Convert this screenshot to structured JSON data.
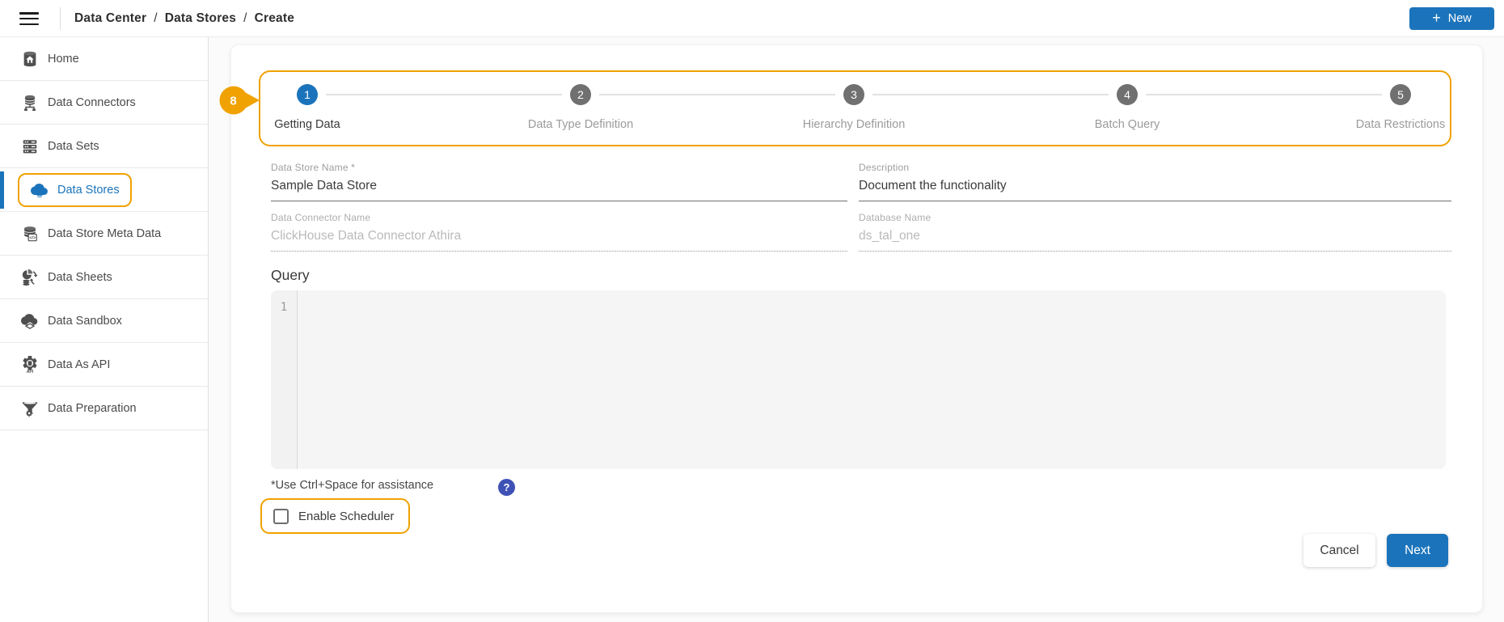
{
  "topbar": {
    "breadcrumb": [
      "Data Center",
      "Data Stores",
      "Create"
    ],
    "separator": "/",
    "new_button": {
      "plus": "+",
      "label": "New"
    }
  },
  "sidebar": {
    "items": [
      {
        "label": "Home",
        "icon": "database-home-icon",
        "active": false
      },
      {
        "label": "Data Connectors",
        "icon": "database-stack-icon",
        "active": false
      },
      {
        "label": "Data Sets",
        "icon": "server-rack-icon",
        "active": false
      },
      {
        "label": "Data Stores",
        "icon": "cloud-icon",
        "active": true
      },
      {
        "label": "Data Store Meta Data",
        "icon": "database-code-icon",
        "active": false
      },
      {
        "label": "Data Sheets",
        "icon": "chart-sync-icon",
        "active": false
      },
      {
        "label": "Data Sandbox",
        "icon": "cloud-box-icon",
        "active": false
      },
      {
        "label": "Data As API",
        "icon": "gear-api-icon",
        "active": false
      },
      {
        "label": "Data Preparation",
        "icon": "funnel-gear-icon",
        "active": false
      }
    ]
  },
  "annotation_badge": {
    "label": "8"
  },
  "stepper": {
    "steps": [
      {
        "number": "1",
        "label": "Getting Data",
        "state": "active"
      },
      {
        "number": "2",
        "label": "Data Type Definition",
        "state": "inactive"
      },
      {
        "number": "3",
        "label": "Hierarchy Definition",
        "state": "inactive"
      },
      {
        "number": "4",
        "label": "Batch Query",
        "state": "inactive"
      },
      {
        "number": "5",
        "label": "Data Restrictions",
        "state": "inactive"
      }
    ]
  },
  "form": {
    "fields": {
      "data_store_name": {
        "label": "Data Store Name *",
        "value": "Sample Data Store",
        "disabled": false
      },
      "description": {
        "label": "Description",
        "value": "Document the functionality",
        "disabled": false
      },
      "data_connector_name": {
        "label": "Data Connector Name",
        "value": "ClickHouse Data Connector Athira",
        "disabled": true
      },
      "database_name": {
        "label": "Database Name",
        "value": "ds_tal_one",
        "disabled": true
      }
    },
    "query": {
      "heading": "Query",
      "line_number": "1",
      "content": ""
    },
    "hint": "*Use Ctrl+Space for assistance",
    "help_icon": "?",
    "scheduler": {
      "label": "Enable Scheduler",
      "checked": false
    }
  },
  "actions": {
    "cancel": "Cancel",
    "next": "Next"
  },
  "colors": {
    "accent_blue": "#1B74BB",
    "highlight_orange": "#F0A202",
    "help_indigo": "#3F51B5"
  }
}
